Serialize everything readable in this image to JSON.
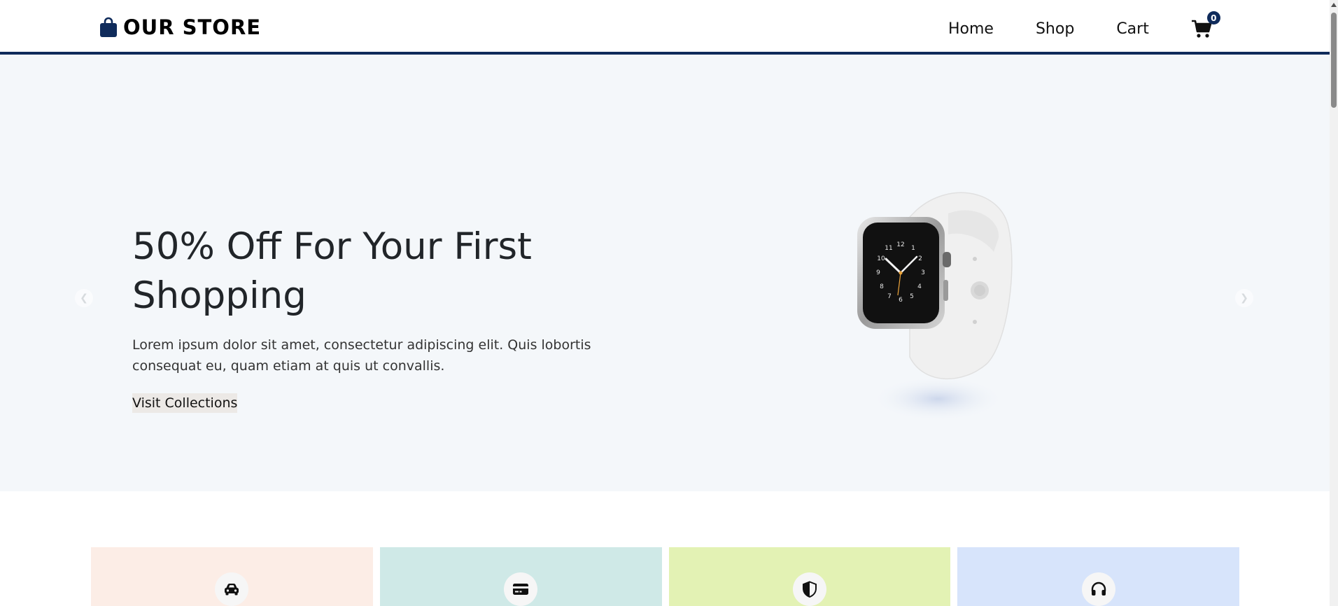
{
  "header": {
    "brand": "OUR STORE",
    "nav": [
      {
        "label": "Home"
      },
      {
        "label": "Shop"
      },
      {
        "label": "Cart"
      }
    ],
    "cart_count": "0",
    "accent": "#0f2b5b"
  },
  "hero": {
    "title": "50% Off For Your First Shopping",
    "description": "Lorem ipsum dolor sit amet, consectetur adipiscing elit. Quis lobortis consequat eu, quam etiam at quis ut convallis.",
    "cta": "Visit Collections",
    "background": "#f4f7fa",
    "prev_icon": "chevron-left-icon",
    "next_icon": "chevron-right-icon",
    "image": "smartwatch-image"
  },
  "features": [
    {
      "icon": "car-icon",
      "color": "#fcede6"
    },
    {
      "icon": "credit-card-icon",
      "color": "#cfe9e7"
    },
    {
      "icon": "shield-icon",
      "color": "#e3f2b4"
    },
    {
      "icon": "headphones-icon",
      "color": "#d7e4fb"
    }
  ]
}
